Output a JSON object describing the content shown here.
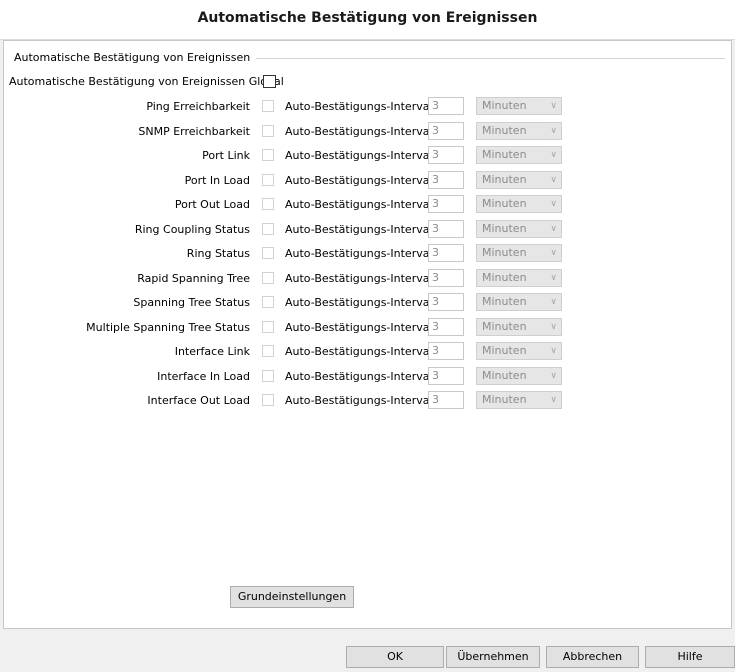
{
  "dialog": {
    "title": "Automatische Bestätigung von Ereignissen"
  },
  "group": {
    "title": "Automatische Bestätigung von Ereignissen",
    "global_label": "Automatische Bestätigung von Ereignissen Global",
    "global_checked": false
  },
  "events": [
    {
      "label": "Ping Erreichbarkeit",
      "interval_label": "Auto-Bestätigungs-Intervall",
      "value": "3",
      "unit": "Minuten"
    },
    {
      "label": "SNMP Erreichbarkeit",
      "interval_label": "Auto-Bestätigungs-Intervall",
      "value": "3",
      "unit": "Minuten"
    },
    {
      "label": "Port Link",
      "interval_label": "Auto-Bestätigungs-Intervall",
      "value": "3",
      "unit": "Minuten"
    },
    {
      "label": "Port In Load",
      "interval_label": "Auto-Bestätigungs-Intervall",
      "value": "3",
      "unit": "Minuten"
    },
    {
      "label": "Port Out Load",
      "interval_label": "Auto-Bestätigungs-Intervall",
      "value": "3",
      "unit": "Minuten"
    },
    {
      "label": "Ring Coupling Status",
      "interval_label": "Auto-Bestätigungs-Intervall",
      "value": "3",
      "unit": "Minuten"
    },
    {
      "label": "Ring Status",
      "interval_label": "Auto-Bestätigungs-Intervall",
      "value": "3",
      "unit": "Minuten"
    },
    {
      "label": "Rapid Spanning Tree",
      "interval_label": "Auto-Bestätigungs-Intervall",
      "value": "3",
      "unit": "Minuten"
    },
    {
      "label": "Spanning Tree Status",
      "interval_label": "Auto-Bestätigungs-Intervall",
      "value": "3",
      "unit": "Minuten"
    },
    {
      "label": "Multiple Spanning Tree Status",
      "interval_label": "Auto-Bestätigungs-Intervall",
      "value": "3",
      "unit": "Minuten"
    },
    {
      "label": "Interface Link",
      "interval_label": "Auto-Bestätigungs-Intervall",
      "value": "3",
      "unit": "Minuten"
    },
    {
      "label": "Interface In Load",
      "interval_label": "Auto-Bestätigungs-Intervall",
      "value": "3",
      "unit": "Minuten"
    },
    {
      "label": "Interface Out Load",
      "interval_label": "Auto-Bestätigungs-Intervall",
      "value": "3",
      "unit": "Minuten"
    }
  ],
  "buttons": {
    "defaults": "Grundeinstellungen",
    "ok": "OK",
    "apply": "Übernehmen",
    "cancel": "Abbrechen",
    "help": "Hilfe"
  }
}
